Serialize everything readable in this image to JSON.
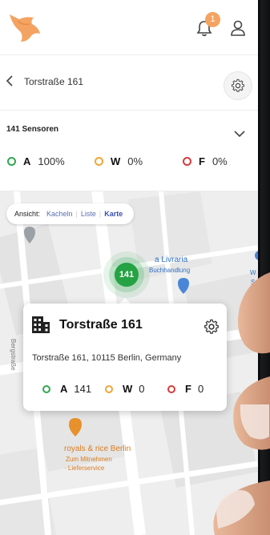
{
  "header": {
    "logo_icon": "fox-logo-icon",
    "notification_count": "1",
    "accent_color": "#f4a362"
  },
  "breadcrumb": {
    "title": "Torstraße 161"
  },
  "sensors": {
    "count_label": "141 Sensoren",
    "stats": [
      {
        "letter": "A",
        "value": "100%",
        "color": "#2fa84f"
      },
      {
        "letter": "W",
        "value": "0%",
        "color": "#f0a637"
      },
      {
        "letter": "F",
        "value": "0%",
        "color": "#d63b3b"
      }
    ]
  },
  "map": {
    "view_label": "Ansicht:",
    "view_options": [
      "Kacheln",
      "Liste",
      "Karte"
    ],
    "view_active": "Karte",
    "cluster_value": "141",
    "poi_bookstore": [
      "a Livraria",
      "Buchhandlung"
    ],
    "poi_letter": "W",
    "poi_letter_s": "S",
    "poi_restaurant": [
      "royals & rice Berlin"
    ],
    "poi_restaurant_sub": [
      "Zum Mitnehmen",
      "· Lieferservice"
    ],
    "street": "Bergstraße"
  },
  "popup": {
    "title": "Torstraße 161",
    "address": "Torstraße 161, 10115 Berlin, Germany",
    "stats": [
      {
        "letter": "A",
        "value": "141",
        "color": "#2fa84f"
      },
      {
        "letter": "W",
        "value": "0",
        "color": "#f0a637"
      },
      {
        "letter": "F",
        "value": "0",
        "color": "#d63b3b"
      }
    ]
  }
}
